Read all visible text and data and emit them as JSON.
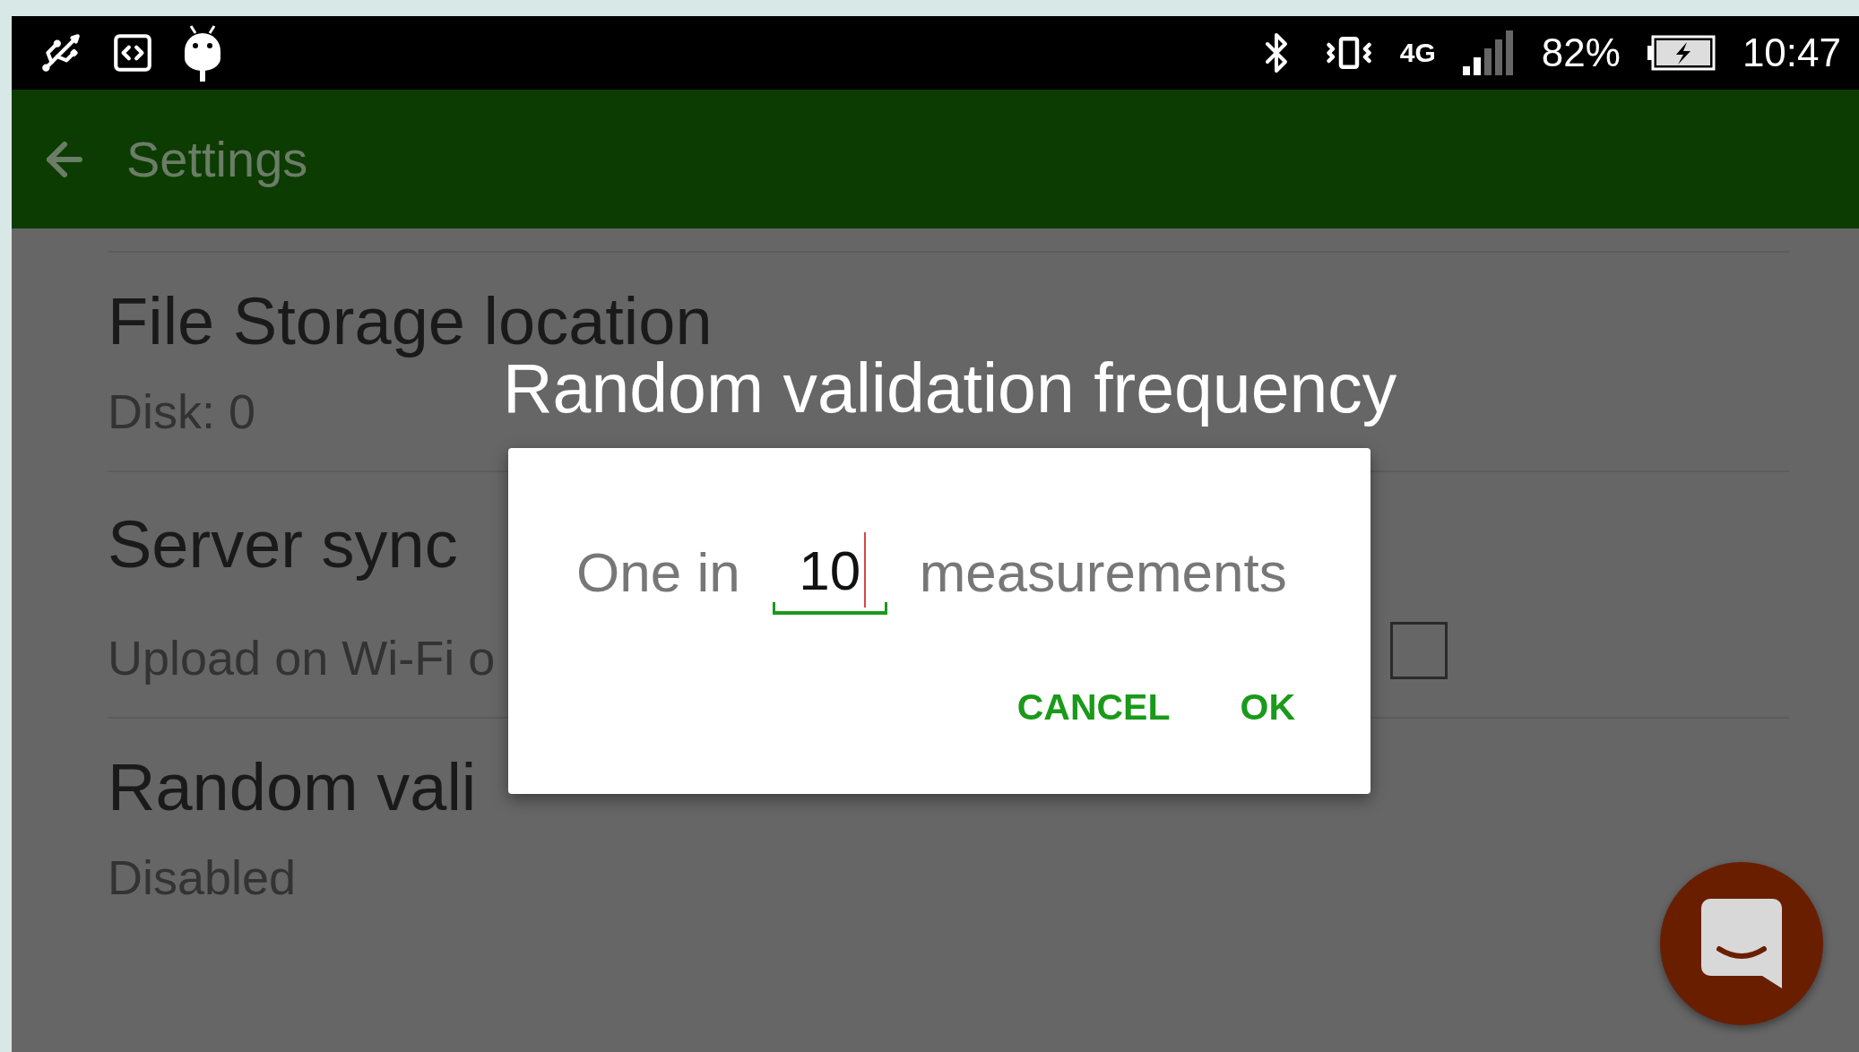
{
  "status_bar": {
    "network_type": "4G",
    "battery": "82%",
    "time": "10:47"
  },
  "app_bar": {
    "title": "Settings"
  },
  "settings": [
    {
      "kind": "text",
      "title": "File Storage location",
      "summary": "Disk: 0"
    },
    {
      "kind": "checkbox",
      "title": "Server sync",
      "summary": "Upload on Wi-Fi o",
      "checked": false
    },
    {
      "kind": "text",
      "title": "Random vali",
      "summary": "Disabled"
    }
  ],
  "dialog": {
    "title": "Random validation frequency",
    "prefix": "One in",
    "value": "10",
    "suffix": "measurements",
    "buttons": [
      "CANCEL",
      "OK"
    ]
  }
}
